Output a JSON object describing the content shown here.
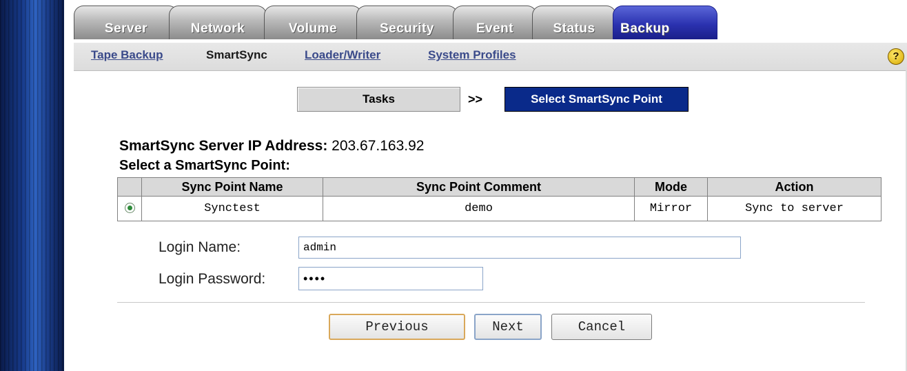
{
  "tabs": [
    "Server",
    "Network",
    "Volume",
    "Security",
    "Event",
    "Status",
    "Backup"
  ],
  "active_tab": "Backup",
  "subnav": {
    "items": [
      "Tape Backup",
      "SmartSync",
      "Loader/Writer",
      "System Profiles"
    ],
    "current": "SmartSync",
    "help_label": "?"
  },
  "steps": {
    "tasks": "Tasks",
    "arrow": ">>",
    "current": "Select SmartSync Point"
  },
  "server": {
    "label": "SmartSync Server IP Address:",
    "ip": "203.67.163.92"
  },
  "select_heading": "Select a SmartSync Point:",
  "table": {
    "headers": [
      "",
      "Sync Point Name",
      "Sync Point Comment",
      "Mode",
      "Action"
    ],
    "rows": [
      {
        "selected": true,
        "name": "Synctest",
        "comment": "demo",
        "mode": "Mirror",
        "action": "Sync to server"
      }
    ]
  },
  "login": {
    "name_label": "Login Name:",
    "name_value": "admin",
    "password_label": "Login Password:",
    "password_value": "••••"
  },
  "buttons": {
    "previous": "Previous",
    "next": "Next",
    "cancel": "Cancel"
  },
  "colors": {
    "active_tab": "#2b32b0",
    "step_current_bg": "#0a2a8a",
    "link": "#3a4a8a"
  }
}
